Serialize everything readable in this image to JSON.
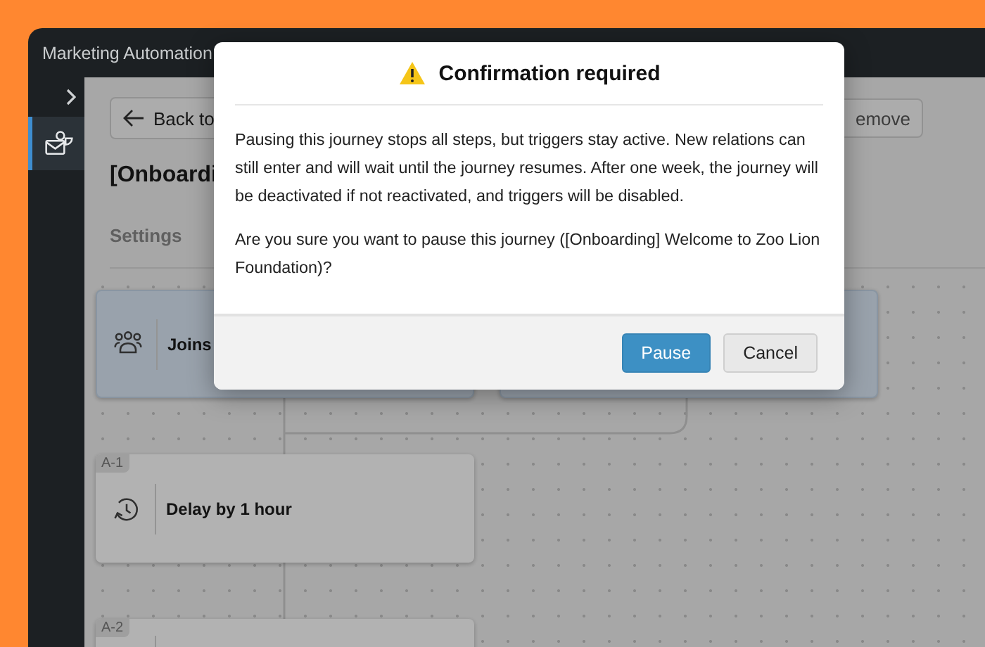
{
  "window": {
    "title": "Marketing Automation"
  },
  "sidebar": {
    "items": [
      {
        "kind": "journeys",
        "selected": true
      }
    ]
  },
  "page": {
    "back_button": "Back to",
    "title": "[Onboardi",
    "tabs": [
      {
        "label": "Settings",
        "selected": false
      }
    ],
    "remove_button": "emove"
  },
  "canvas": {
    "steps": [
      {
        "kind": "trigger",
        "label": "Joins",
        "selected": true
      },
      {
        "kind": "trigger",
        "selected": true
      },
      {
        "kind": "delay",
        "badge": "A-1",
        "label": "Delay by 1 hour",
        "selected": false
      },
      {
        "kind": "action",
        "badge": "A-2",
        "selected": false
      }
    ]
  },
  "dialog": {
    "title": "Confirmation required",
    "paragraphs": [
      "Pausing this journey stops all steps, but triggers stay active. New relations can still enter and will wait until the journey resumes. After one week, the journey will be deactivated if not reactivated, and triggers will be disabled.",
      "Are you sure you want to pause this journey ([Onboarding] Welcome to Zoo Lion Foundation)?"
    ],
    "buttons": [
      {
        "label": "Pause",
        "kind": "primary"
      },
      {
        "label": "Cancel",
        "kind": "secondary"
      }
    ]
  }
}
